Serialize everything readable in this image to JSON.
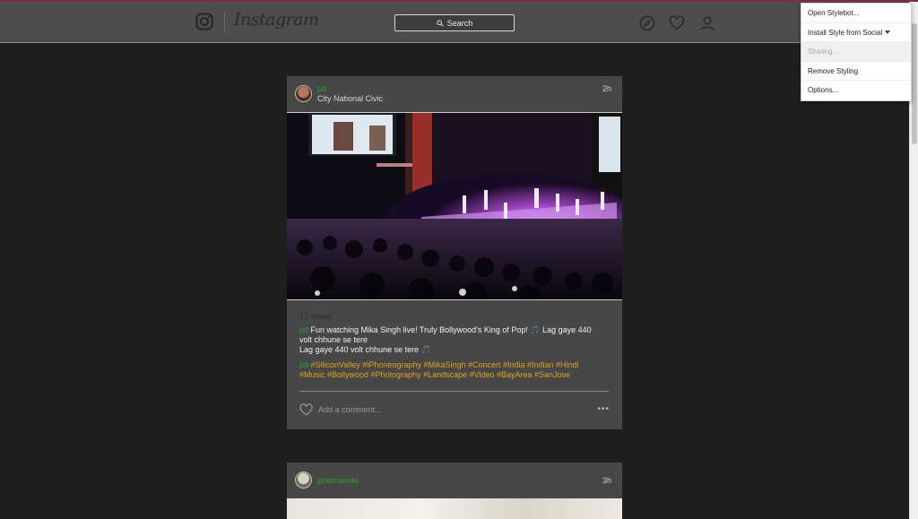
{
  "header": {
    "logo_text": "Instagram",
    "search_label": "Search"
  },
  "posts": [
    {
      "username": "pd",
      "location": "City National Civic",
      "time": "2h",
      "views": "17 views",
      "caption_user": "pd",
      "caption_line1": "Fun watching Mika Singh live! Truly Bollywood's King of Pop! 🎵 Lag gaye 440 volt chhune se tere",
      "caption_line2": "Lag gaye 440 volt chhune se tere 🎵",
      "tags_user": "pd",
      "tags": "#SiliconValley #iPhoneography #MikaSingh #Concert #India #Indian #Hindi #Music #Bollywood #Photography #Landscape #Video #BayArea #SanJose",
      "comment_placeholder": "Add a comment...",
      "more": "•••"
    },
    {
      "username": "pokimaneki",
      "time": "3h"
    }
  ],
  "extension_menu": {
    "items": [
      {
        "label": "Open Stylebot...",
        "enabled": true
      },
      {
        "label": "Install Style from Social",
        "enabled": true
      },
      {
        "label": "Sharing...",
        "enabled": false
      },
      {
        "label": "Remove Styling",
        "enabled": true
      },
      {
        "label": "Options...",
        "enabled": true
      }
    ]
  },
  "colors": {
    "header_bg": "#4d4d4d",
    "page_bg": "#1f1f1f",
    "post_bg": "#474747",
    "username": "#2f9e2f",
    "hashtag": "#e0a21a"
  }
}
